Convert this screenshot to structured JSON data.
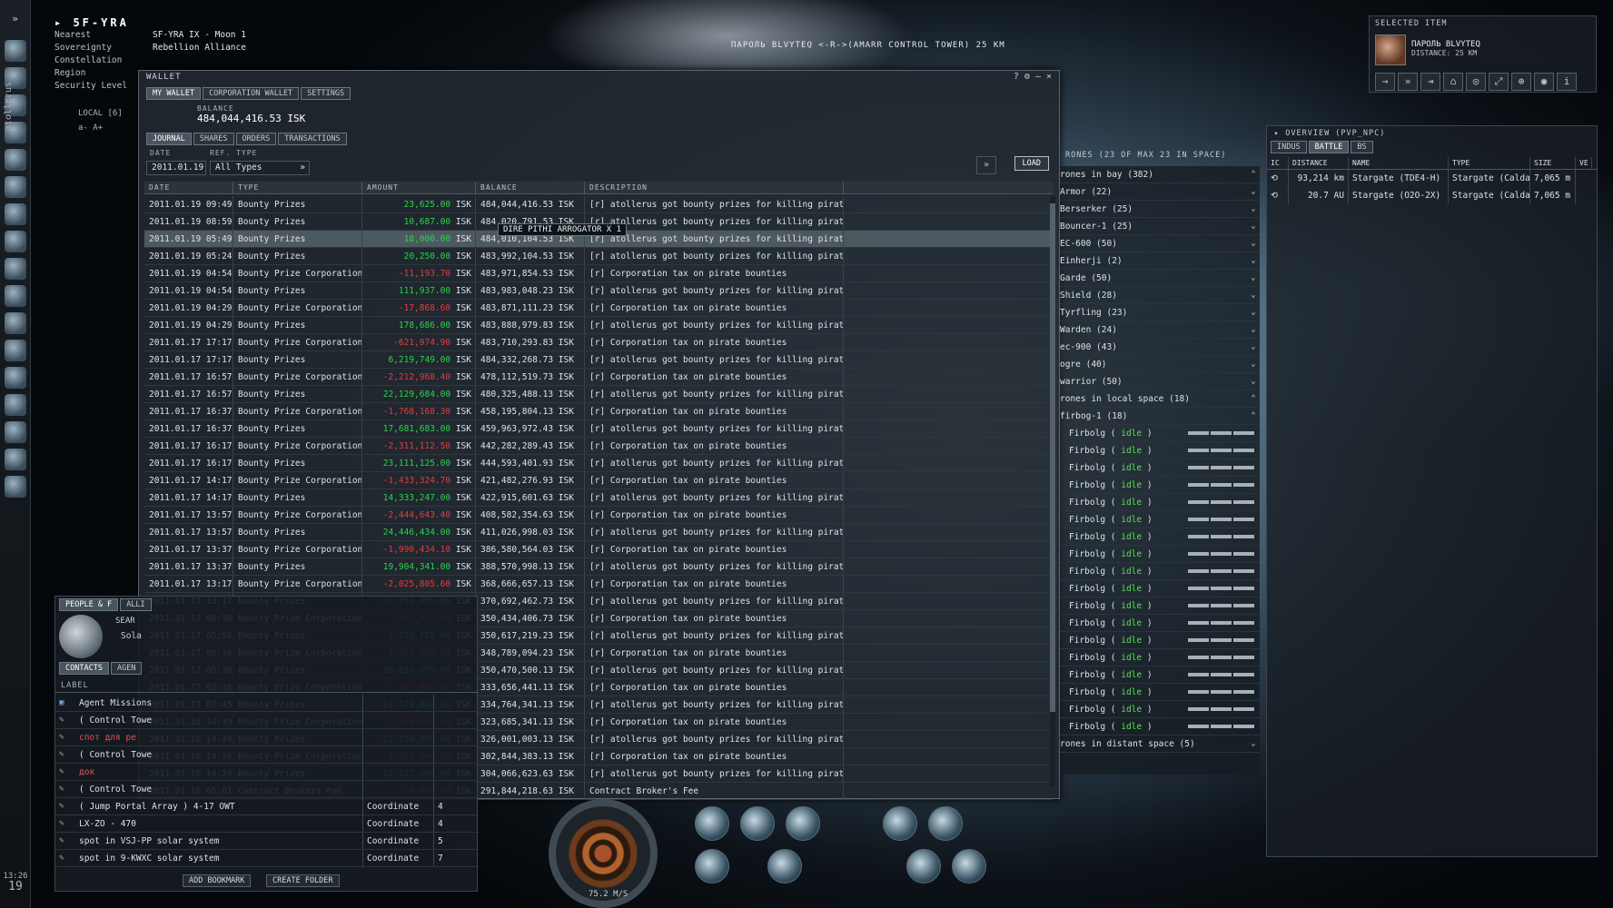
{
  "sidebar": {
    "pilot": "atollerus",
    "time": "13:26",
    "day": "19"
  },
  "location": {
    "system": "5F-YRA",
    "rows": [
      {
        "k": "Nearest",
        "v": "SF-YRA IX - Moon 1"
      },
      {
        "k": "Sovereignty",
        "v": "Rebellion Alliance"
      },
      {
        "k": "Constellation",
        "v": ""
      },
      {
        "k": "Region",
        "v": ""
      },
      {
        "k": "Security Level",
        "v": ""
      }
    ]
  },
  "space_label": "ПАРОЛЬ BLVYTEQ <-R->(AMARR CONTROL TOWER) 25 KM",
  "local": {
    "label": "LOCAL [6]",
    "zoom": "a- A+"
  },
  "wallet": {
    "title": "WALLET",
    "tabs": [
      "MY WALLET",
      "CORPORATION WALLET",
      "SETTINGS"
    ],
    "balance_label": "BALANCE",
    "balance": "484,044,416.53 ISK",
    "subtabs": [
      "JOURNAL",
      "SHARES",
      "ORDERS",
      "TRANSACTIONS"
    ],
    "date_label": "DATE",
    "date": "2011.01.19",
    "reftype_label": "REF. TYPE",
    "reftype": "All Types",
    "load": "LOAD",
    "cols": [
      "DATE",
      "TYPE",
      "AMOUNT",
      "BALANCE",
      "DESCRIPTION"
    ],
    "tooltip": "DIRE PITHI ARROGATOR X 1",
    "rows": [
      [
        "2011.01.19 09:49",
        "Bounty Prizes",
        "23,625.00",
        "484,044,416.53 ISK",
        "[r] atollerus got bounty prizes for killing pirates in 5F-YRA",
        "pos"
      ],
      [
        "2011.01.19 08:59",
        "Bounty Prizes",
        "10,687.00",
        "484,020,791.53 ISK",
        "[r] atollerus got bounty prizes for killing pirates in 5F-YRA",
        "pos"
      ],
      [
        "2011.01.19 05:49",
        "Bounty Prizes",
        "18,000.00",
        "484,010,104.53 ISK",
        "[r] atollerus got bounty prizes for killing pirates in 5F-YRA",
        "pos"
      ],
      [
        "2011.01.19 05:24",
        "Bounty Prizes",
        "20,250.00",
        "483,992,104.53 ISK",
        "[r] atollerus got bounty prizes for killing pirates in 5F-YRA",
        "pos"
      ],
      [
        "2011.01.19 04:54",
        "Bounty Prize Corporation Tax",
        "-11,193.70",
        "483,971,854.53 ISK",
        "[r] Corporation tax on pirate bounties",
        "neg"
      ],
      [
        "2011.01.19 04:54",
        "Bounty Prizes",
        "111,937.00",
        "483,983,048.23 ISK",
        "[r] atollerus got bounty prizes for killing pirates in 5F-YRA",
        "pos"
      ],
      [
        "2011.01.19 04:29",
        "Bounty Prize Corporation Tax",
        "-17,868.60",
        "483,871,111.23 ISK",
        "[r] Corporation tax on pirate bounties",
        "neg"
      ],
      [
        "2011.01.19 04:29",
        "Bounty Prizes",
        "178,686.00",
        "483,888,979.83 ISK",
        "[r] atollerus got bounty prizes for killing pirates in 5F-YRA",
        "pos"
      ],
      [
        "2011.01.17 17:17",
        "Bounty Prize Corporation Tax",
        "-621,974.90",
        "483,710,293.83 ISK",
        "[r] Corporation tax on pirate bounties",
        "neg"
      ],
      [
        "2011.01.17 17:17",
        "Bounty Prizes",
        "6,219,749.00",
        "484,332,268.73 ISK",
        "[r] atollerus got bounty prizes for killing pirates in 5F-YRA",
        "pos"
      ],
      [
        "2011.01.17 16:57",
        "Bounty Prize Corporation Tax",
        "-2,212,968.40",
        "478,112,519.73 ISK",
        "[r] Corporation tax on pirate bounties",
        "neg"
      ],
      [
        "2011.01.17 16:57",
        "Bounty Prizes",
        "22,129,684.00",
        "480,325,488.13 ISK",
        "[r] atollerus got bounty prizes for killing pirates in 5F-YRA",
        "pos"
      ],
      [
        "2011.01.17 16:37",
        "Bounty Prize Corporation Tax",
        "-1,768,168.30",
        "458,195,804.13 ISK",
        "[r] Corporation tax on pirate bounties",
        "neg"
      ],
      [
        "2011.01.17 16:37",
        "Bounty Prizes",
        "17,681,683.00",
        "459,963,972.43 ISK",
        "[r] atollerus got bounty prizes for killing pirates in 5F-YRA",
        "pos"
      ],
      [
        "2011.01.17 16:17",
        "Bounty Prize Corporation Tax",
        "-2,311,112.50",
        "442,282,289.43 ISK",
        "[r] Corporation tax on pirate bounties",
        "neg"
      ],
      [
        "2011.01.17 16:17",
        "Bounty Prizes",
        "23,111,125.00",
        "444,593,401.93 ISK",
        "[r] atollerus got bounty prizes for killing pirates in 5F-YRA",
        "pos"
      ],
      [
        "2011.01.17 14:17",
        "Bounty Prize Corporation Tax",
        "-1,433,324.70",
        "421,482,276.93 ISK",
        "[r] Corporation tax on pirate bounties",
        "neg"
      ],
      [
        "2011.01.17 14:17",
        "Bounty Prizes",
        "14,333,247.00",
        "422,915,601.63 ISK",
        "[r] atollerus got bounty prizes for killing pirates in 5F-YRA",
        "pos"
      ],
      [
        "2011.01.17 13:57",
        "Bounty Prize Corporation Tax",
        "-2,444,643.40",
        "408,582,354.63 ISK",
        "[r] Corporation tax on pirate bounties",
        "neg"
      ],
      [
        "2011.01.17 13:57",
        "Bounty Prizes",
        "24,446,434.00",
        "411,026,998.03 ISK",
        "[r] atollerus got bounty prizes for killing pirates in 5F-YRA",
        "pos"
      ],
      [
        "2011.01.17 13:37",
        "Bounty Prize Corporation Tax",
        "-1,990,434.10",
        "386,580,564.03 ISK",
        "[r] Corporation tax on pirate bounties",
        "neg"
      ],
      [
        "2011.01.17 13:37",
        "Bounty Prizes",
        "19,904,341.00",
        "388,570,998.13 ISK",
        "[r] atollerus got bounty prizes for killing pirates in 5F-YRA",
        "pos"
      ],
      [
        "2011.01.17 13:17",
        "Bounty Prize Corporation Tax",
        "-2,025,805.60",
        "368,666,657.13 ISK",
        "[r] Corporation tax on pirate bounties",
        "neg"
      ],
      [
        "2011.01.17 13:17",
        "Bounty Prizes",
        "20,258,056.00",
        "370,692,462.73 ISK",
        "[r] atollerus got bounty prizes for killing pirates in 5F-YRA",
        "pos"
      ],
      [
        "2011.01.17 05:56",
        "Bounty Prize Corporation Tax",
        "-182,812.50",
        "350,434,406.73 ISK",
        "[r] Corporation tax on pirate bounties",
        "neg"
      ],
      [
        "2011.01.17 05:56",
        "Bounty Prizes",
        "1,828,125.00",
        "350,617,219.23 ISK",
        "[r] atollerus got bounty prizes for killing pirates in 5F-YRA",
        "pos"
      ],
      [
        "2011.01.17 05:36",
        "Bounty Prize Corporation Tax",
        "-1,681,405.90",
        "348,789,094.23 ISK",
        "[r] Corporation tax on pirate bounties",
        "neg"
      ],
      [
        "2011.01.17 05:36",
        "Bounty Prizes",
        "16,814,059.00",
        "350,470,500.13 ISK",
        "[r] atollerus got bounty prizes for killing pirates in 5F-YRA",
        "pos"
      ],
      [
        "2011.01.17 02:45",
        "Bounty Prize Corporation Tax",
        "-1,107,900.00",
        "333,656,441.13 ISK",
        "[r] Corporation tax on pirate bounties",
        "neg"
      ],
      [
        "2011.01.17 02:45",
        "Bounty Prizes",
        "11,079,000.00",
        "334,764,341.13 ISK",
        "[r] atollerus got bounty prizes for killing pirates in 5F-YRA",
        "pos"
      ],
      [
        "2011.01.16 14:49",
        "Bounty Prize Corporation Tax",
        "-2,316,662.00",
        "323,685,341.13 ISK",
        "[r] Corporation tax on pirate bounties",
        "neg"
      ],
      [
        "2011.01.16 14:49",
        "Bounty Prizes",
        "23,156,620.00",
        "326,001,003.13 ISK",
        "[r] atollerus got bounty prizes for killing pirates in 5F-YRA",
        "pos"
      ],
      [
        "2011.01.16 14:29",
        "Bounty Prize Corporation Tax",
        "-1,222,240.50",
        "302,844,383.13 ISK",
        "[r] Corporation tax on pirate bounties",
        "neg"
      ],
      [
        "2011.01.16 14:29",
        "Bounty Prizes",
        "12,222,405.00",
        "304,066,623.63 ISK",
        "[r] atollerus got bounty prizes for killing pirates in 5F-YRA",
        "pos"
      ],
      [
        "2011.01.16 05:01",
        "Contract Brokers Fee",
        "-10,000.00",
        "291,844,218.63 ISK",
        "Contract Broker's Fee",
        "neg"
      ]
    ]
  },
  "selected": {
    "title": "SELECTED ITEM",
    "name": "ПАРОЛЬ BLVYTEQ",
    "distance": "DISTANCE: 25 KM"
  },
  "overview": {
    "title": "OVERVIEW (PVP_NPC)",
    "tabs": [
      "INDUS",
      "BATTLE",
      "BS"
    ],
    "cols": [
      "IC",
      "DISTANCE",
      "NAME",
      "TYPE",
      "SIZE",
      "VE"
    ],
    "rows": [
      [
        "93,214 km",
        "Stargate (TDE4-H)",
        "Stargate (Caldari",
        "7,065 m"
      ],
      [
        "20.7 AU",
        "Stargate (O2O-2X)",
        "Stargate (Caldari",
        "7,065 m"
      ]
    ]
  },
  "drones": {
    "title": "RONES (23 OF MAX 23 IN SPACE)",
    "bay": "rones in bay (382)",
    "groups": [
      "Armor (22)",
      "Berserker (25)",
      "Bouncer-1 (25)",
      "EC-600 (50)",
      "Einherji (2)",
      "Garde (50)",
      "Shield (28)",
      "Tyrfling (23)",
      "Warden (24)",
      "ec-900 (43)",
      "ogre (40)",
      "warrior (50)"
    ],
    "local": "rones in local space (18)",
    "local_group": "firbog-1 (18)",
    "drone": "Firbolg",
    "state": "idle",
    "distant": "rones in distant space (5)"
  },
  "people": {
    "tabs": [
      "PEOPLE & F",
      "ALLI"
    ],
    "search": "SEAR",
    "search_val": "Sola",
    "subtabs": [
      "CONTACTS",
      "AGEN"
    ],
    "label_col": "LABEL",
    "rows": [
      {
        "l": "Agent Missions",
        "t": "",
        "n": ""
      },
      {
        "l": "( Control Towe",
        "t": "",
        "n": ""
      },
      {
        "l": "спот для ре",
        "t": "",
        "n": ""
      },
      {
        "l": "( Control Towe",
        "t": "",
        "n": ""
      },
      {
        "l": "док",
        "t": "",
        "n": ""
      },
      {
        "l": "( Control Towe",
        "t": "",
        "n": ""
      },
      {
        "l": "( Jump Portal Array ) 4-17 OWT",
        "t": "Coordinate",
        "n": "4"
      },
      {
        "l": "LX-ZO - 470",
        "t": "Coordinate",
        "n": "4"
      },
      {
        "l": "spot in VSJ-PP solar system",
        "t": "Coordinate",
        "n": "5"
      },
      {
        "l": "spot in 9-KWXC solar system",
        "t": "Coordinate",
        "n": "7"
      }
    ],
    "add": "ADD BOOKMARK",
    "folder": "CREATE FOLDER"
  },
  "hud": {
    "speed": "75.2 M/S"
  }
}
